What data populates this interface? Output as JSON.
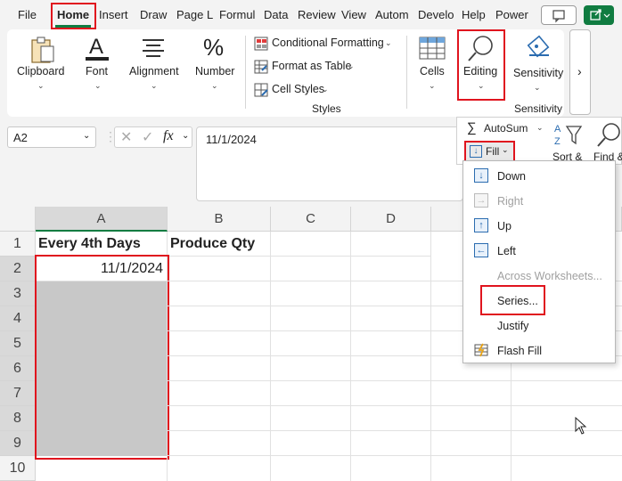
{
  "tabs": [
    "File",
    "Home",
    "Insert",
    "Draw",
    "Page L",
    "Formul",
    "Data",
    "Review",
    "View",
    "Autom",
    "Develo",
    "Help",
    "Power"
  ],
  "ribbon": {
    "clipboard": "Clipboard",
    "font": "Font",
    "alignment": "Alignment",
    "number": "Number",
    "conditional_formatting": "Conditional Formatting",
    "format_as_table": "Format as Table",
    "cell_styles": "Cell Styles",
    "styles_group": "Styles",
    "cells": "Cells",
    "editing": "Editing",
    "sensitivity": "Sensitivity",
    "sensitivity_group": "Sensitivity",
    "more": "›"
  },
  "formula_bar": {
    "name_box": "A2",
    "fx_label": "fx",
    "value": "11/1/2024"
  },
  "editing_panel": {
    "autosum": "AutoSum",
    "fill": "Fill",
    "sort": "Sort &",
    "find": "Find &"
  },
  "fill_menu": {
    "down": "Down",
    "right": "Right",
    "up": "Up",
    "left": "Left",
    "across": "Across Worksheets...",
    "series": "Series...",
    "justify": "Justify",
    "flash_fill": "Flash Fill"
  },
  "sheet": {
    "columns": [
      "A",
      "B",
      "C",
      "D"
    ],
    "rows": [
      "1",
      "2",
      "3",
      "4",
      "5",
      "6",
      "7",
      "8",
      "9",
      "10"
    ],
    "A1": "Every 4th Days",
    "B1": "Produce Qty",
    "A2": "11/1/2024"
  },
  "colors": {
    "accent_green": "#107c41",
    "highlight_red": "#e0141e",
    "selection_gray": "#c8c8c8"
  }
}
